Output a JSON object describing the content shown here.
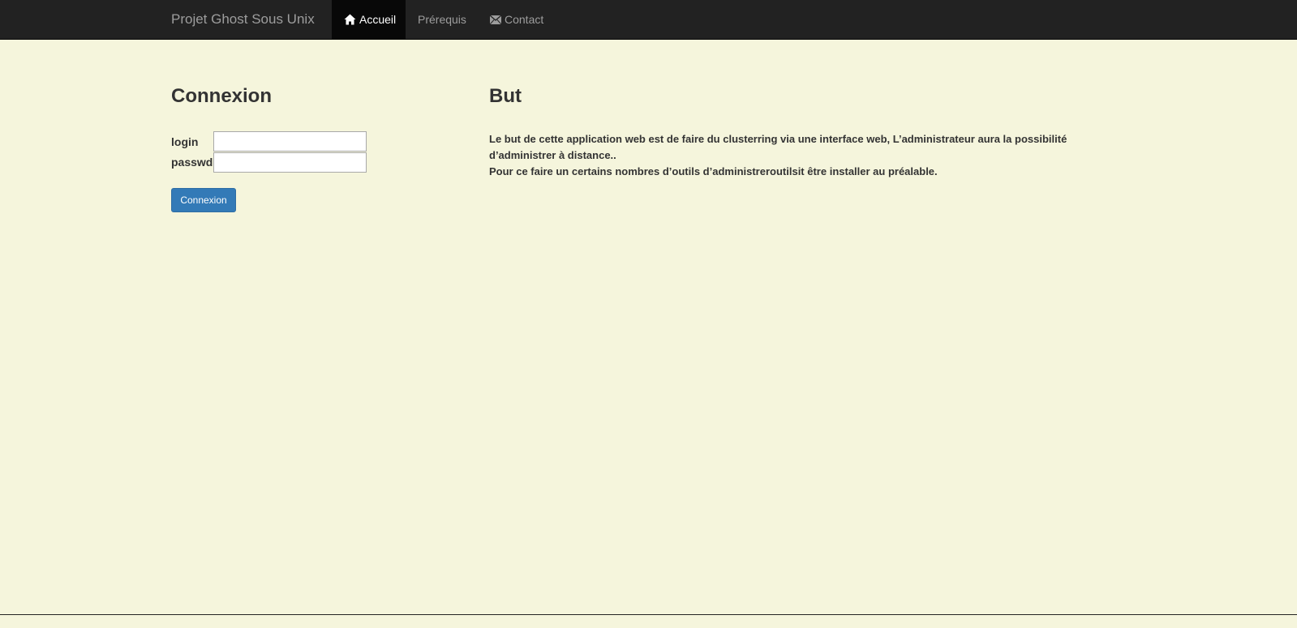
{
  "navbar": {
    "brand": "Projet Ghost Sous Unix",
    "items": [
      {
        "label": "Accueil",
        "icon": "home-icon",
        "active": true
      },
      {
        "label": "Prérequis",
        "icon": "",
        "active": false
      },
      {
        "label": "Contact",
        "icon": "envelope-icon",
        "active": false
      }
    ]
  },
  "login": {
    "title": "Connexion",
    "login_label": "login",
    "login_value": "",
    "passwd_label": "passwd",
    "passwd_value": "",
    "submit_label": "Connexion"
  },
  "but": {
    "title": "But",
    "paragraph1": "Le but de cette application web est de faire du clusterring via une interface web, L’administrateur aura la possibilité d’administrer à distance..",
    "paragraph2": "Pour ce faire un certains nombres d’outils d’administreroutilsit être installer au préalable."
  },
  "colors": {
    "background": "#f5f5dc",
    "navbar": "#222222",
    "navbar_active": "#080808",
    "button": "#337ab7",
    "text": "#333333"
  }
}
